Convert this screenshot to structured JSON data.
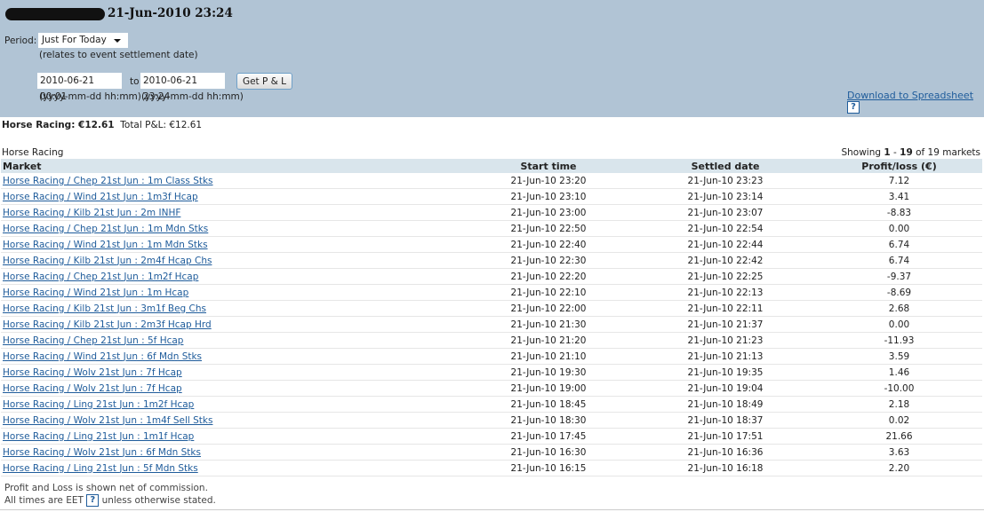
{
  "header": {
    "title": "21-Jun-2010 23:24"
  },
  "filters": {
    "period_label": "Period:",
    "period_value": "Just For Today",
    "period_note": "(relates to event settlement date)",
    "from_value": "2010-06-21 00:01",
    "to_label": "to",
    "to_value": "2010-06-21 23:24",
    "format_hint": "(yyyy-mm-dd hh:mm)",
    "get_button": "Get P & L",
    "download_link": "Download to Spreadsheet",
    "help": "?"
  },
  "summary": {
    "sport_label": "Horse Racing: €12.61",
    "total_label": "Total P&L:  €12.61"
  },
  "section": {
    "title": "Horse Racing",
    "showing_prefix": "Showing ",
    "from": "1",
    "sep": " - ",
    "to": "19",
    "suffix": " of 19 markets"
  },
  "table": {
    "headers": [
      "Market",
      "Start time",
      "Settled date",
      "Profit/loss (€)"
    ],
    "rows": [
      [
        "Horse Racing / Chep 21st Jun : 1m Class Stks",
        "21-Jun-10 23:20",
        "21-Jun-10 23:23",
        "7.12"
      ],
      [
        "Horse Racing / Wind 21st Jun : 1m3f Hcap",
        "21-Jun-10 23:10",
        "21-Jun-10 23:14",
        "3.41"
      ],
      [
        "Horse Racing / Kilb 21st Jun : 2m INHF",
        "21-Jun-10 23:00",
        "21-Jun-10 23:07",
        "-8.83"
      ],
      [
        "Horse Racing / Chep 21st Jun : 1m Mdn Stks",
        "21-Jun-10 22:50",
        "21-Jun-10 22:54",
        "0.00"
      ],
      [
        "Horse Racing / Wind 21st Jun : 1m Mdn Stks",
        "21-Jun-10 22:40",
        "21-Jun-10 22:44",
        "6.74"
      ],
      [
        "Horse Racing / Kilb 21st Jun : 2m4f Hcap Chs",
        "21-Jun-10 22:30",
        "21-Jun-10 22:42",
        "6.74"
      ],
      [
        "Horse Racing / Chep 21st Jun : 1m2f Hcap",
        "21-Jun-10 22:20",
        "21-Jun-10 22:25",
        "-9.37"
      ],
      [
        "Horse Racing / Wind 21st Jun : 1m Hcap",
        "21-Jun-10 22:10",
        "21-Jun-10 22:13",
        "-8.69"
      ],
      [
        "Horse Racing / Kilb 21st Jun : 3m1f Beg Chs",
        "21-Jun-10 22:00",
        "21-Jun-10 22:11",
        "2.68"
      ],
      [
        "Horse Racing / Kilb 21st Jun : 2m3f Hcap Hrd",
        "21-Jun-10 21:30",
        "21-Jun-10 21:37",
        "0.00"
      ],
      [
        "Horse Racing / Chep 21st Jun : 5f Hcap",
        "21-Jun-10 21:20",
        "21-Jun-10 21:23",
        "-11.93"
      ],
      [
        "Horse Racing / Wind 21st Jun : 6f Mdn Stks",
        "21-Jun-10 21:10",
        "21-Jun-10 21:13",
        "3.59"
      ],
      [
        "Horse Racing / Wolv 21st Jun : 7f Hcap",
        "21-Jun-10 19:30",
        "21-Jun-10 19:35",
        "1.46"
      ],
      [
        "Horse Racing / Wolv 21st Jun : 7f Hcap",
        "21-Jun-10 19:00",
        "21-Jun-10 19:04",
        "-10.00"
      ],
      [
        "Horse Racing / Ling 21st Jun : 1m2f Hcap",
        "21-Jun-10 18:45",
        "21-Jun-10 18:49",
        "2.18"
      ],
      [
        "Horse Racing / Wolv 21st Jun : 1m4f Sell Stks",
        "21-Jun-10 18:30",
        "21-Jun-10 18:37",
        "0.02"
      ],
      [
        "Horse Racing / Ling 21st Jun : 1m1f Hcap",
        "21-Jun-10 17:45",
        "21-Jun-10 17:51",
        "21.66"
      ],
      [
        "Horse Racing / Wolv 21st Jun : 6f Mdn Stks",
        "21-Jun-10 16:30",
        "21-Jun-10 16:36",
        "3.63"
      ],
      [
        "Horse Racing / Ling 21st Jun : 5f Mdn Stks",
        "21-Jun-10 16:15",
        "21-Jun-10 16:18",
        "2.20"
      ]
    ]
  },
  "footer": {
    "line1": "Profit and Loss is shown net of commission.",
    "line2_prefix": "All times are EET",
    "line2_suffix": "unless otherwise stated."
  }
}
